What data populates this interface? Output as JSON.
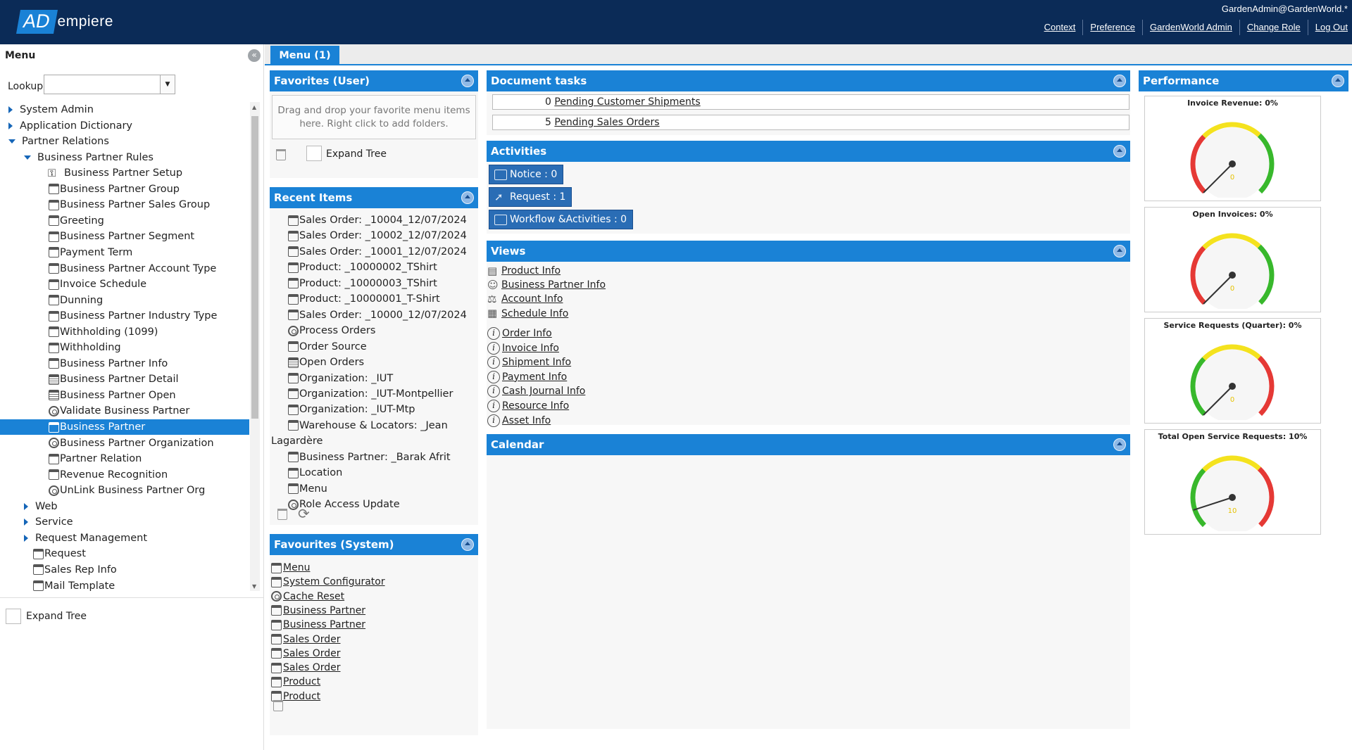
{
  "header": {
    "logo_ad": "AD",
    "logo_rest": "empiere",
    "user": "GardenAdmin@GardenWorld.*",
    "links": [
      "Context",
      "Preference",
      "GardenWorld Admin",
      "Change Role",
      "Log Out"
    ]
  },
  "menu_panel": {
    "title": "Menu",
    "lookup_label": "Lookup:",
    "lookup_value": "",
    "expand_tree_label": "Expand Tree",
    "tree": [
      {
        "label": "System Admin",
        "icon": "triangle-right"
      },
      {
        "label": "Application Dictionary",
        "icon": "triangle-right"
      },
      {
        "label": "Partner Relations",
        "icon": "triangle-down"
      },
      {
        "label": "Business Partner Rules",
        "icon": "triangle-down"
      },
      {
        "label": "Business Partner Setup",
        "icon": "setup-icon"
      },
      {
        "label": "Business Partner Group",
        "icon": "window-icon"
      },
      {
        "label": "Business Partner Sales Group",
        "icon": "window-icon"
      },
      {
        "label": "Greeting",
        "icon": "window-icon"
      },
      {
        "label": "Business Partner Segment",
        "icon": "window-icon"
      },
      {
        "label": "Payment Term",
        "icon": "window-icon"
      },
      {
        "label": "Business Partner Account Type",
        "icon": "window-icon"
      },
      {
        "label": "Invoice Schedule",
        "icon": "window-icon"
      },
      {
        "label": "Dunning",
        "icon": "window-icon"
      },
      {
        "label": "Business Partner Industry Type",
        "icon": "window-icon"
      },
      {
        "label": "Withholding (1099)",
        "icon": "window-icon"
      },
      {
        "label": "Withholding",
        "icon": "window-icon"
      },
      {
        "label": "Business Partner Info",
        "icon": "window-icon"
      },
      {
        "label": "Business Partner Detail",
        "icon": "report-icon"
      },
      {
        "label": "Business Partner Open",
        "icon": "report-icon"
      },
      {
        "label": "Validate Business Partner",
        "icon": "process-icon"
      },
      {
        "label": "Business Partner",
        "icon": "window-icon",
        "selected": true
      },
      {
        "label": "Business Partner Organization",
        "icon": "process-icon"
      },
      {
        "label": "Partner Relation",
        "icon": "window-icon"
      },
      {
        "label": "Revenue Recognition",
        "icon": "window-icon"
      },
      {
        "label": "UnLink Business Partner Org",
        "icon": "process-icon"
      },
      {
        "label": "Web",
        "icon": "triangle-right"
      },
      {
        "label": "Service",
        "icon": "triangle-right"
      },
      {
        "label": "Request Management",
        "icon": "triangle-right"
      },
      {
        "label": "Request",
        "icon": "window-icon"
      },
      {
        "label": "Sales Rep Info",
        "icon": "window-icon"
      },
      {
        "label": "Mail Template",
        "icon": "window-icon"
      }
    ]
  },
  "tabs": [
    {
      "label": "Menu (1)"
    }
  ],
  "favorites_user": {
    "title": "Favorites (User)",
    "hint": "Drag and drop your favorite menu items here. Right click to add folders.",
    "expand_tree_label": "Expand Tree"
  },
  "recent_items": {
    "title": "Recent Items",
    "items": [
      {
        "label": "Sales Order: _10004_12/07/2024",
        "icon": "window-icon"
      },
      {
        "label": "Sales Order: _10002_12/07/2024",
        "icon": "window-icon"
      },
      {
        "label": "Sales Order: _10001_12/07/2024",
        "icon": "window-icon"
      },
      {
        "label": "Product: _10000002_TShirt",
        "icon": "window-icon"
      },
      {
        "label": "Product: _10000003_TShirt",
        "icon": "window-icon"
      },
      {
        "label": "Product: _10000001_T-Shirt",
        "icon": "window-icon"
      },
      {
        "label": "Sales Order: _10000_12/07/2024",
        "icon": "window-icon"
      },
      {
        "label": "Process Orders",
        "icon": "process-icon"
      },
      {
        "label": "Order Source",
        "icon": "window-icon"
      },
      {
        "label": "Open Orders",
        "icon": "report-icon"
      },
      {
        "label": "Organization: _IUT",
        "icon": "window-icon"
      },
      {
        "label": "Organization: _IUT-Montpellier",
        "icon": "window-icon"
      },
      {
        "label": "Organization: _IUT-Mtp",
        "icon": "window-icon"
      },
      {
        "label": "Warehouse & Locators: _Jean",
        "icon": "window-icon"
      },
      {
        "label": "Lagardère",
        "icon": "none"
      },
      {
        "label": "Business Partner: _Barak Afrit",
        "icon": "window-icon"
      },
      {
        "label": "Location",
        "icon": "window-icon"
      },
      {
        "label": "Menu",
        "icon": "window-icon"
      },
      {
        "label": "Role Access Update",
        "icon": "process-icon"
      }
    ]
  },
  "favourites_system": {
    "title": "Favourites (System)",
    "items": [
      {
        "label": "Menu",
        "icon": "window-icon"
      },
      {
        "label": "System Configurator",
        "icon": "window-icon"
      },
      {
        "label": "Cache Reset",
        "icon": "process-icon"
      },
      {
        "label": "Business Partner",
        "icon": "window-icon"
      },
      {
        "label": "Business Partner",
        "icon": "window-icon"
      },
      {
        "label": "Sales Order",
        "icon": "window-icon"
      },
      {
        "label": "Sales Order",
        "icon": "window-icon"
      },
      {
        "label": "Sales Order",
        "icon": "window-icon"
      },
      {
        "label": "Product",
        "icon": "window-icon"
      },
      {
        "label": "Product",
        "icon": "window-icon"
      }
    ]
  },
  "document_tasks": {
    "title": "Document tasks",
    "items": [
      {
        "count": "0",
        "label": "Pending Customer Shipments"
      },
      {
        "count": "5",
        "label": "Pending Sales Orders"
      }
    ]
  },
  "activities": {
    "title": "Activities",
    "buttons": [
      {
        "label": "Notice : 0",
        "icon": "mail-icon"
      },
      {
        "label": "Request : 1",
        "icon": "send-icon"
      },
      {
        "label": "Workflow &Activities : 0",
        "icon": "workflow-icon"
      }
    ]
  },
  "views": {
    "title": "Views",
    "group1": [
      {
        "label": "Product Info",
        "icon": "product-icon"
      },
      {
        "label": "Business Partner Info",
        "icon": "person-icon"
      },
      {
        "label": "Account Info",
        "icon": "scale-icon"
      },
      {
        "label": "Schedule Info",
        "icon": "calendar-icon"
      }
    ],
    "group2": [
      {
        "label": "Order Info",
        "icon": "info-icon"
      },
      {
        "label": "Invoice Info",
        "icon": "info-icon"
      },
      {
        "label": "Shipment Info",
        "icon": "info-icon"
      },
      {
        "label": "Payment Info",
        "icon": "info-icon"
      },
      {
        "label": "Cash Journal Info",
        "icon": "info-icon"
      },
      {
        "label": "Resource Info",
        "icon": "info-icon"
      },
      {
        "label": "Asset Info",
        "icon": "info-icon"
      }
    ]
  },
  "calendar": {
    "title": "Calendar"
  },
  "performance": {
    "title": "Performance",
    "gauges": [
      {
        "title": "Invoice Revenue: 0%",
        "value": 0,
        "value_label": "0"
      },
      {
        "title": "Open Invoices: 0%",
        "value": 0,
        "value_label": "0"
      },
      {
        "title": "Service Requests (Quarter): 0%",
        "value": 0,
        "value_label": "0"
      },
      {
        "title": "Total Open Service Requests: 10%",
        "value": 10,
        "value_label": "10"
      }
    ]
  },
  "colors": {
    "header_bg": "#0b2b57",
    "accent": "#1a82d6",
    "gauge_red": "#e53935",
    "gauge_yellow": "#f4e21e",
    "gauge_green": "#38b82c"
  }
}
